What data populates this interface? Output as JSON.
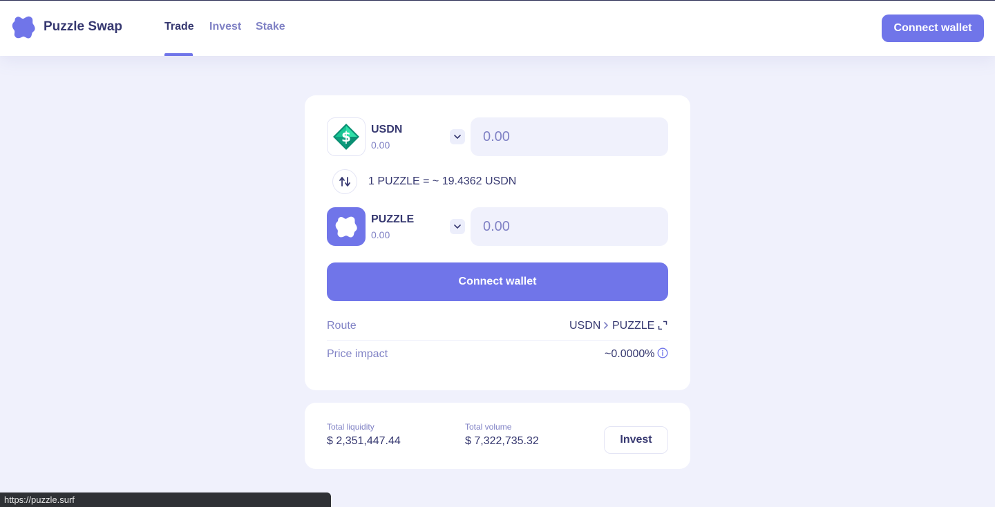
{
  "app": {
    "brand": "Puzzle Swap",
    "accent_color": "#7075e9",
    "text_color": "#363870",
    "muted_color": "#8082c5"
  },
  "nav": {
    "tabs": [
      {
        "label": "Trade",
        "active": true
      },
      {
        "label": "Invest",
        "active": false
      },
      {
        "label": "Stake",
        "active": false
      }
    ],
    "connect_label": "Connect wallet"
  },
  "swap": {
    "from": {
      "symbol": "USDN",
      "balance": "0.00",
      "amount_placeholder": "0.00",
      "icon": "usdn-diamond-dollar-icon",
      "icon_colors": [
        "#1fcf98",
        "#0a8f73"
      ]
    },
    "to": {
      "symbol": "PUZZLE",
      "balance": "0.00",
      "amount_placeholder": "0.00",
      "icon": "puzzle-logo-icon"
    },
    "rate": "1 PUZZLE = ~ 19.4362 USDN",
    "connect_label": "Connect wallet",
    "route": {
      "label": "Route",
      "from": "USDN",
      "to": "PUZZLE"
    },
    "price_impact": {
      "label": "Price impact",
      "value": "~0.0000%"
    }
  },
  "stats": {
    "liquidity_label": "Total liquidity",
    "liquidity_value": "$ 2,351,447.44",
    "volume_label": "Total volume",
    "volume_value": "$ 7,322,735.32",
    "invest_label": "Invest"
  },
  "status_bar": {
    "url": "https://puzzle.surf"
  }
}
